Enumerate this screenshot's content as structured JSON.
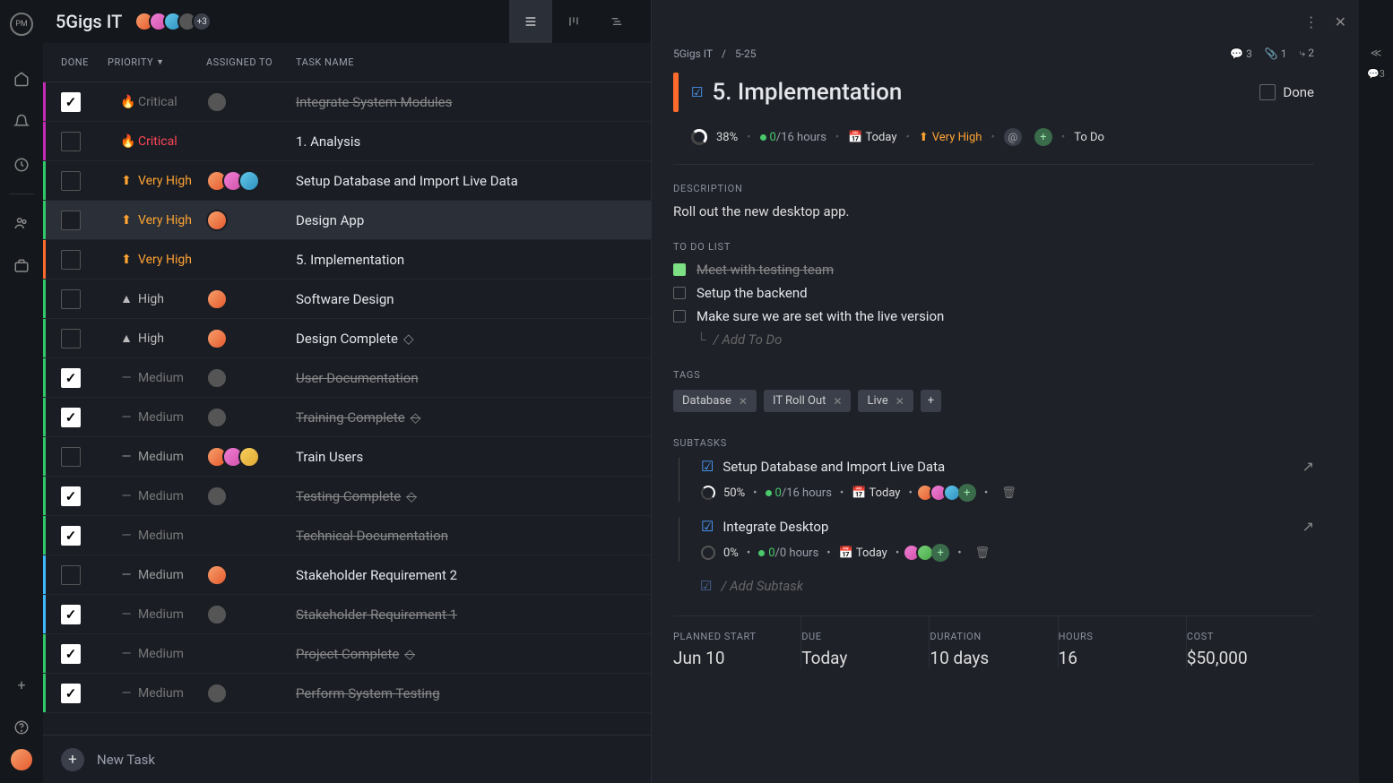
{
  "project": {
    "name": "5Gigs IT",
    "avatar_more": "+3"
  },
  "columns": {
    "done": "DONE",
    "priority": "PRIORITY",
    "assigned": "ASSIGNED TO",
    "name": "TASK NAME"
  },
  "priorities": {
    "critical": "Critical",
    "very_high": "Very High",
    "high": "High",
    "medium": "Medium"
  },
  "tasks": [
    {
      "id": 0,
      "done": true,
      "priority": "critical",
      "stripe": "#c22cb3",
      "name": "Integrate System Modules",
      "assignees": [
        "a5"
      ],
      "milestone": false
    },
    {
      "id": 1,
      "done": false,
      "priority": "critical",
      "stripe": "#c22cb3",
      "name": "1. Analysis",
      "assignees": [],
      "milestone": false
    },
    {
      "id": 2,
      "done": false,
      "priority": "very_high",
      "stripe": "#30c868",
      "name": "Setup Database and Import Live Data",
      "assignees": [
        "a1",
        "a2",
        "a3"
      ],
      "milestone": false
    },
    {
      "id": 3,
      "done": false,
      "priority": "very_high",
      "stripe": "#30c868",
      "name": "Design App",
      "assignees": [
        "a1"
      ],
      "milestone": false,
      "selected": true
    },
    {
      "id": 4,
      "done": false,
      "priority": "very_high",
      "stripe": "#ff6b2c",
      "name": "5. Implementation",
      "assignees": [],
      "milestone": false
    },
    {
      "id": 5,
      "done": false,
      "priority": "high",
      "stripe": "#30c868",
      "name": "Software Design",
      "assignees": [
        "a1"
      ],
      "milestone": false
    },
    {
      "id": 6,
      "done": false,
      "priority": "high",
      "stripe": "#30c868",
      "name": "Design Complete",
      "assignees": [
        "a1"
      ],
      "milestone": true
    },
    {
      "id": 7,
      "done": true,
      "priority": "medium",
      "stripe": "#30c868",
      "name": "User Documentation",
      "assignees": [
        "a5"
      ],
      "milestone": false
    },
    {
      "id": 8,
      "done": true,
      "priority": "medium",
      "stripe": "#30c868",
      "name": "Training Complete",
      "assignees": [
        "a5"
      ],
      "milestone": true
    },
    {
      "id": 9,
      "done": false,
      "priority": "medium",
      "stripe": "#30c868",
      "name": "Train Users",
      "assignees": [
        "a1",
        "a2",
        "a6"
      ],
      "milestone": false
    },
    {
      "id": 10,
      "done": true,
      "priority": "medium",
      "stripe": "#30c868",
      "name": "Testing Complete",
      "assignees": [
        "a5"
      ],
      "milestone": true
    },
    {
      "id": 11,
      "done": true,
      "priority": "medium",
      "stripe": "#30c868",
      "name": "Technical Documentation",
      "assignees": [],
      "milestone": false
    },
    {
      "id": 12,
      "done": false,
      "priority": "medium",
      "stripe": "#40b8ff",
      "name": "Stakeholder Requirement 2",
      "assignees": [
        "a1"
      ],
      "milestone": false
    },
    {
      "id": 13,
      "done": true,
      "priority": "medium",
      "stripe": "#40b8ff",
      "name": "Stakeholder Requirement 1",
      "assignees": [
        "a5"
      ],
      "milestone": false
    },
    {
      "id": 14,
      "done": true,
      "priority": "medium",
      "stripe": "#30c868",
      "name": "Project Complete",
      "assignees": [],
      "milestone": true
    },
    {
      "id": 15,
      "done": true,
      "priority": "medium",
      "stripe": "#30c868",
      "name": "Perform System Testing",
      "assignees": [
        "a5"
      ],
      "milestone": false
    }
  ],
  "new_task": {
    "label": "New Task"
  },
  "detail": {
    "breadcrumb": {
      "project": "5Gigs IT",
      "task": "5-25"
    },
    "counts": {
      "comments": 3,
      "attachments": 1,
      "subtasks": 2
    },
    "title": "5. Implementation",
    "done_label": "Done",
    "stats": {
      "progress": "38%",
      "hours_done": "0",
      "hours_total": "/16 hours",
      "due": "Today",
      "priority": "Very High",
      "status": "To Do"
    },
    "description_label": "DESCRIPTION",
    "description": "Roll out the new desktop app.",
    "todo_label": "TO DO LIST",
    "todos": [
      {
        "done": true,
        "text": "Meet with testing team"
      },
      {
        "done": false,
        "text": "Setup the backend"
      },
      {
        "done": false,
        "text": "Make sure we are set with the live version"
      }
    ],
    "add_todo": "/ Add To Do",
    "tags_label": "TAGS",
    "tags": [
      "Database",
      "IT Roll Out",
      "Live"
    ],
    "subtasks_label": "SUBTASKS",
    "subtasks": [
      {
        "title": "Setup Database and Import Live Data",
        "progress": "50%",
        "hours_done": "0",
        "hours_total": "/16 hours",
        "due": "Today",
        "assignees": [
          "a1",
          "a2",
          "a3"
        ]
      },
      {
        "title": "Integrate Desktop",
        "progress": "0%",
        "hours_done": "0",
        "hours_total": "/0 hours",
        "due": "Today",
        "assignees": [
          "a2",
          "a4"
        ]
      }
    ],
    "add_subtask": "/ Add Subtask",
    "bottom": {
      "planned_start": {
        "label": "PLANNED START",
        "value": "Jun 10"
      },
      "due": {
        "label": "DUE",
        "value": "Today"
      },
      "duration": {
        "label": "DURATION",
        "value": "10 days"
      },
      "hours": {
        "label": "HOURS",
        "value": "16"
      },
      "cost": {
        "label": "COST",
        "value": "$50,000"
      }
    }
  },
  "right_gutter": {
    "comments": 3
  }
}
